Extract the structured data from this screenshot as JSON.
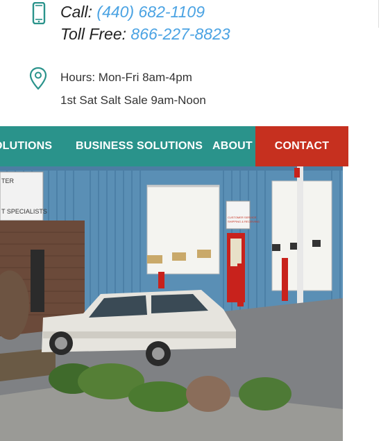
{
  "contact": {
    "call_label": "Call:",
    "call_number": "(440) 682-1109",
    "tollfree_label": "Toll Free:",
    "tollfree_number": "866-227-8823",
    "hours_line1": "Hours: Mon-Fri 8am-4pm",
    "hours_line2": "1st Sat Salt Sale 9am-Noon",
    "icons": [
      "phone-icon",
      "map-pin-icon"
    ],
    "icon_color": "#2a938b",
    "link_color": "#4ba3e3"
  },
  "nav": {
    "items": [
      {
        "label": "OLUTIONS"
      },
      {
        "label": "BUSINESS SOLUTIONS"
      },
      {
        "label": "ABOUT"
      },
      {
        "label": "CONTACT"
      }
    ],
    "bg_color": "#2a938b",
    "active_color": "#c6301f"
  },
  "hero": {
    "sign_line1": "TER",
    "sign_line2": "T SPECIALISTS",
    "door_sign_line1": "CUSTOMER SERVICE",
    "door_sign_line2": "SHIPPING & RECEIVING"
  }
}
